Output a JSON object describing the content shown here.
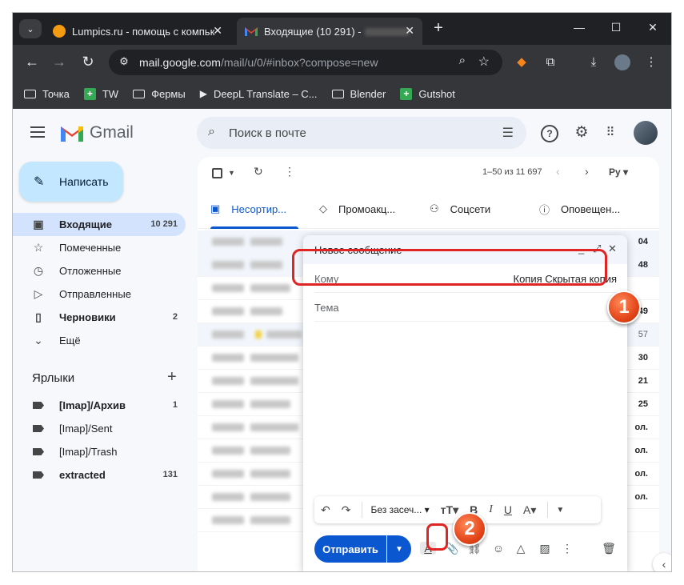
{
  "browser": {
    "tabs": [
      {
        "title": "Lumpics.ru - помощь с компьк",
        "active": false
      },
      {
        "title": "Входящие (10 291) -",
        "active": true
      }
    ],
    "url_host": "mail.google.com",
    "url_path": "/mail/u/0/#inbox?compose=new",
    "bookmarks": [
      {
        "label": "Точка",
        "icon": "folder-icon"
      },
      {
        "label": "TW",
        "icon": "sheets-icon"
      },
      {
        "label": "Фермы",
        "icon": "folder-icon"
      },
      {
        "label": "DeepL Translate – C...",
        "icon": "deepl-icon"
      },
      {
        "label": "Blender",
        "icon": "folder-icon"
      },
      {
        "label": "Gutshot",
        "icon": "sheets-icon"
      }
    ]
  },
  "gmail": {
    "logo_text": "Gmail",
    "search_placeholder": "Поиск в почте",
    "compose_label": "Написать",
    "nav": [
      {
        "label": "Входящие",
        "count": "10 291",
        "icon": "inbox-icon",
        "active": true
      },
      {
        "label": "Помеченные",
        "count": "",
        "icon": "star-icon"
      },
      {
        "label": "Отложенные",
        "count": "",
        "icon": "clock-icon"
      },
      {
        "label": "Отправленные",
        "count": "",
        "icon": "send-icon"
      },
      {
        "label": "Черновики",
        "count": "2",
        "icon": "draft-icon",
        "bold": true
      },
      {
        "label": "Ещё",
        "count": "",
        "icon": "chevron-down-icon"
      }
    ],
    "labels_heading": "Ярлыки",
    "labels": [
      {
        "label": "[Imap]/Архив",
        "count": "1",
        "bold": true
      },
      {
        "label": "[Imap]/Sent",
        "count": ""
      },
      {
        "label": "[Imap]/Trash",
        "count": ""
      },
      {
        "label": "extracted",
        "count": "131",
        "bold": true
      }
    ],
    "pagination": "1–50 из 11 697",
    "lang": "Ру",
    "inbox_tabs": [
      {
        "label": "Несортир...",
        "icon": "inbox-icon",
        "active": true
      },
      {
        "label": "Промоакц...",
        "icon": "tag-icon"
      },
      {
        "label": "Соцсети",
        "icon": "people-icon"
      },
      {
        "label": "Оповещен...",
        "icon": "info-icon"
      }
    ],
    "row_dates": [
      "04",
      "48",
      "",
      "49",
      "57",
      "30",
      "21",
      "25",
      "ол.",
      "ол.",
      "ол.",
      "ол.",
      ""
    ]
  },
  "compose": {
    "title": "Новое сообщение",
    "to_label": "Кому",
    "cc_bcc": "Копия Скрытая копия",
    "subject_label": "Тема",
    "font_name": "Без засеч...",
    "send_label": "Отправить"
  },
  "annotations": {
    "badge1": "1",
    "badge2": "2",
    "highlight_color": "#e02424"
  }
}
